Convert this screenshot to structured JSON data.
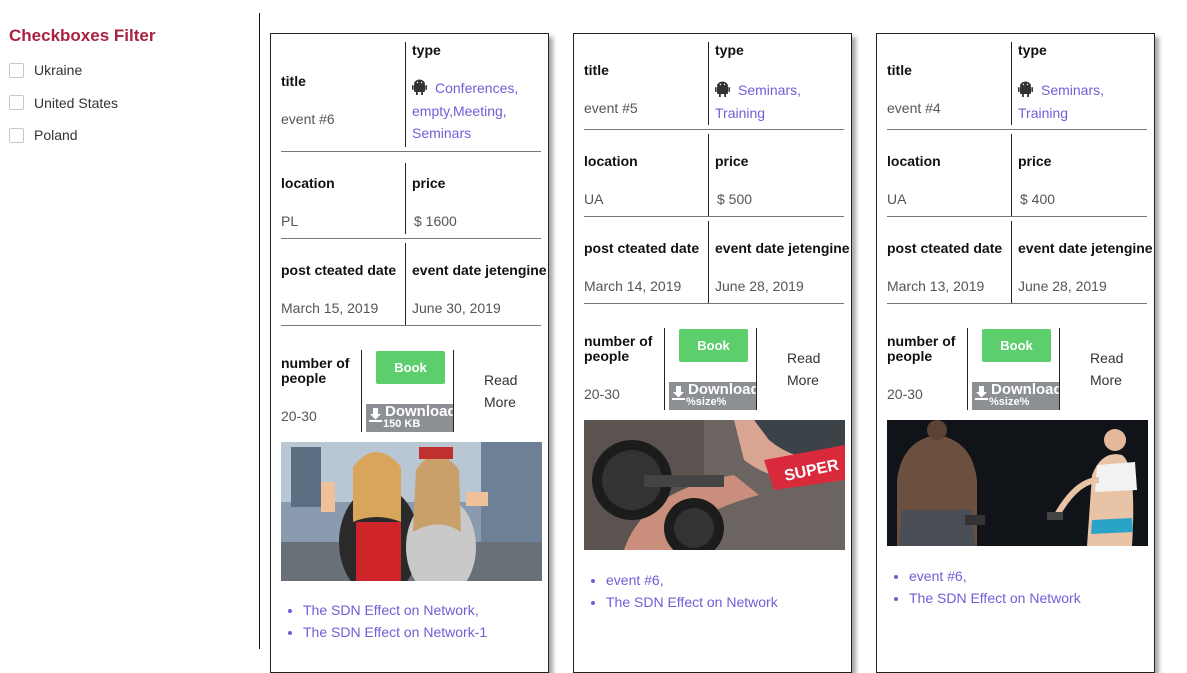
{
  "filter": {
    "title": "Checkboxes Filter",
    "options": [
      "Ukraine",
      "United States",
      "Poland"
    ]
  },
  "labels": {
    "title": "title",
    "type": "type",
    "location": "location",
    "price": "price",
    "post_created": "post cteated date",
    "event_date": "event date jetengine",
    "people": "number of people",
    "book": "Book",
    "download": "Download",
    "read_more": "Read More"
  },
  "cards": [
    {
      "title": "event #6",
      "types": [
        "Conferences,",
        "empty,",
        "Meeting,",
        "Seminars"
      ],
      "location": "PL",
      "price": "$ 1600",
      "post_created": "March 15, 2019",
      "event_date": "June 30, 2019",
      "people": "20-30",
      "download_size": "150 KB",
      "links": [
        "The SDN Effect on Network,",
        "The SDN Effect on Network-1"
      ]
    },
    {
      "title": "event #5",
      "types": [
        "Seminars,",
        "Training"
      ],
      "location": "UA",
      "price": "$ 500",
      "post_created": "March 14, 2019",
      "event_date": "June 28, 2019",
      "people": "20-30",
      "download_size": "%size%",
      "links": [
        "event #6,",
        "The SDN Effect on Network"
      ]
    },
    {
      "title": "event #4",
      "types": [
        "Seminars,",
        "Training"
      ],
      "location": "UA",
      "price": "$ 400",
      "post_created": "March 13, 2019",
      "event_date": "June 28, 2019",
      "people": "20-30",
      "download_size": "%size%",
      "links": [
        "event #6,",
        "The SDN Effect on Network"
      ]
    }
  ],
  "colors": {
    "filter_title": "#a8233f",
    "link": "#6e5fd6",
    "book_button": "#5cce6c",
    "download_button": "#8c8f94"
  },
  "icons": {
    "type": "android-icon",
    "download": "download-icon"
  }
}
